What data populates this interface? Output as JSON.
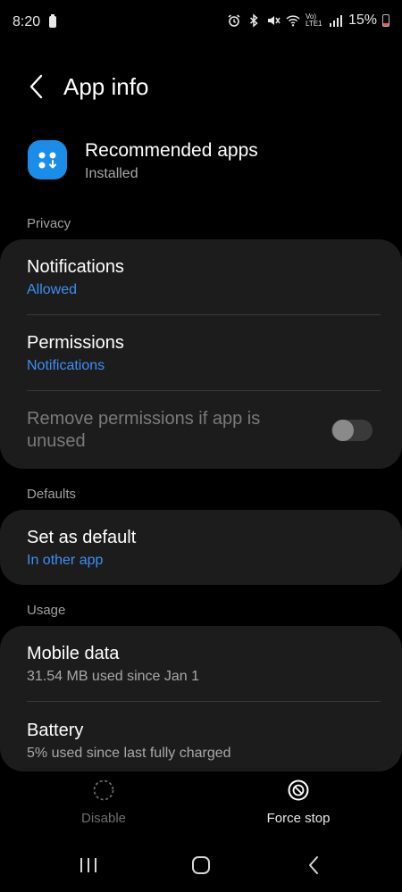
{
  "status_bar": {
    "time": "8:20",
    "battery_percent": "15%",
    "network_label": "Vo) LTE1",
    "battery_level_fraction": 0.15
  },
  "header": {
    "title": "App info"
  },
  "app": {
    "name": "Recommended apps",
    "status": "Installed",
    "icon_color": "#1a8de8"
  },
  "privacy": {
    "section_label": "Privacy",
    "notifications": {
      "title": "Notifications",
      "value": "Allowed"
    },
    "permissions": {
      "title": "Permissions",
      "value": "Notifications"
    },
    "remove_unused": {
      "title": "Remove permissions if app is unused",
      "enabled": false
    }
  },
  "defaults": {
    "section_label": "Defaults",
    "set_as_default": {
      "title": "Set as default",
      "value": "In other app"
    }
  },
  "usage": {
    "section_label": "Usage",
    "mobile_data": {
      "title": "Mobile data",
      "value": "31.54 MB used since Jan 1"
    },
    "battery": {
      "title": "Battery",
      "value": "5% used since last fully charged"
    }
  },
  "actions": {
    "disable_label": "Disable",
    "force_stop_label": "Force stop"
  },
  "colors": {
    "accent": "#3d8ff5",
    "card_bg": "#1c1c1c",
    "page_bg": "#000000"
  }
}
